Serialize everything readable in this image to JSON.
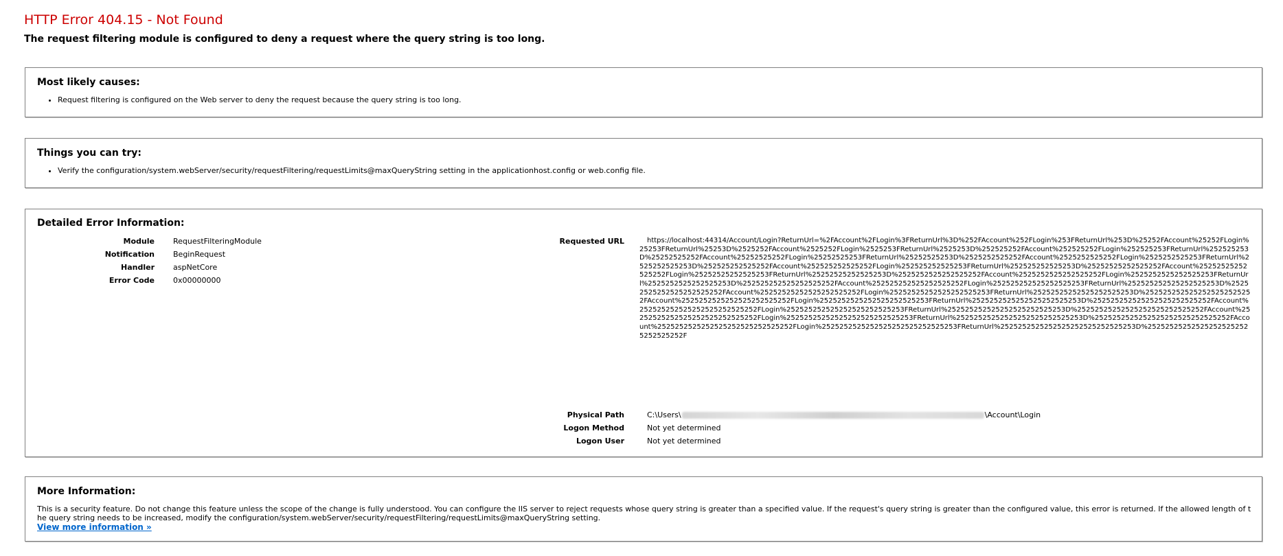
{
  "header": {
    "title": "HTTP Error 404.15 - Not Found",
    "summary": "The request filtering module is configured to deny a request where the query string is too long."
  },
  "causes": {
    "heading": "Most likely causes:",
    "items": [
      "Request filtering is configured on the Web server to deny the request because the query string is too long."
    ]
  },
  "try": {
    "heading": "Things you can try:",
    "items": [
      "Verify the configuration/system.webServer/security/requestFiltering/requestLimits@maxQueryString setting in the applicationhost.config or web.config file."
    ]
  },
  "details": {
    "heading": "Detailed Error Information:",
    "module_label": "Module",
    "module_value": "RequestFilteringModule",
    "notification_label": "Notification",
    "notification_value": "BeginRequest",
    "handler_label": "Handler",
    "handler_value": "aspNetCore",
    "errorcode_label": "Error Code",
    "errorcode_value": "0x00000000",
    "url_label": "Requested URL",
    "url_value": "https://localhost:44314/Account/Login?ReturnUrl=%2FAccount%2FLogin%3FReturnUrl%3D%252FAccount%252FLogin%253FReturnUrl%253D%25252FAccount%25252FLogin%25253FReturnUrl%25253D%2525252FAccount%2525252FLogin%2525253FReturnUrl%2525253D%252525252FAccount%252525252FLogin%252525253FReturnUrl%252525253D%25252525252FAccount%25252525252FLogin%25252525253FReturnUrl%25252525253D%2525252525252FAccount%2525252525252FLogin%2525252525253FReturnUrl%2525252525253D%252525252525252FAccount%252525252525252FLogin%252525252525253FReturnUrl%252525252525253D%25252525252525252FAccount%25252525252525252FLogin%25252525252525253FReturnUrl%25252525252525253D%2525252525252525252FAccount%2525252525252525252FLogin%2525252525252525253FReturnUrl%2525252525252525253D%252525252525252525252FAccount%252525252525252525252FLogin%252525252525252525253FReturnUrl%252525252525252525253D%25252525252525252525252FAccount%25252525252525252525252FLogin%25252525252525252525253FReturnUrl%25252525252525252525253D%2525252525252525252525252FAccount%2525252525252525252525252FLogin%2525252525252525252525253FReturnUrl%2525252525252525252525253D%252525252525252525252525252FAccount%252525252525252525252525252FLogin%252525252525252525252525253FReturnUrl%252525252525252525252525253D%25252525252525252525252525252FAccount%25252525252525252525252525252FLogin%25252525252525252525252525253FReturnUrl%25252525252525252525252525253D%2525252525252525252525252525252FAccount%2525252525252525252525252525252FLogin%2525252525252525252525252525253FReturnUrl%2525252525252525252525252525253D%252525252525252525252525252525252F",
    "path_label": "Physical Path",
    "path_prefix": "C:\\Users\\",
    "path_suffix": "\\Account\\Login",
    "logon_method_label": "Logon Method",
    "logon_method_value": "Not yet determined",
    "logon_user_label": "Logon User",
    "logon_user_value": "Not yet determined"
  },
  "more": {
    "heading": "More Information:",
    "text": "This is a security feature. Do not change this feature unless the scope of the change is fully understood. You can configure the IIS server to reject requests whose query string is greater than a specified value. If the request's query string is greater than the configured value, this error is returned. If the allowed length of the query string needs to be increased, modify the configuration/system.webServer/security/requestFiltering/requestLimits@maxQueryString setting.",
    "link": "View more information »"
  },
  "colors": {
    "title": "#cc0000",
    "link": "#0066cc",
    "border": "#808080"
  }
}
